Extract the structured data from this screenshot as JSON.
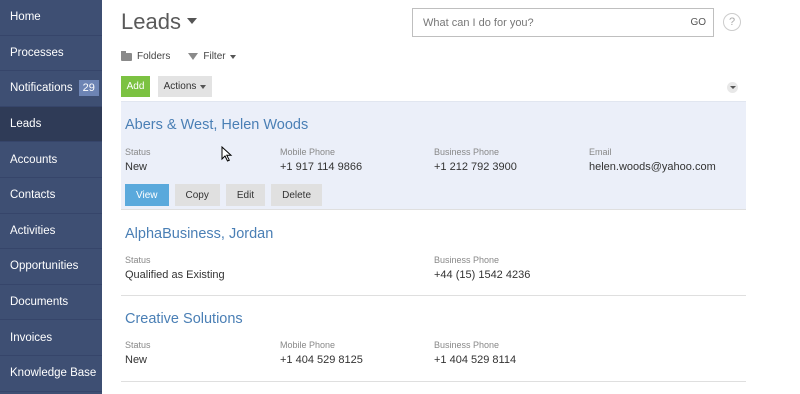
{
  "sidebar": {
    "items": [
      {
        "label": "Home"
      },
      {
        "label": "Processes"
      },
      {
        "label": "Notifications",
        "badge": "29"
      },
      {
        "label": "Leads"
      },
      {
        "label": "Accounts"
      },
      {
        "label": "Contacts"
      },
      {
        "label": "Activities"
      },
      {
        "label": "Opportunities"
      },
      {
        "label": "Documents"
      },
      {
        "label": "Invoices"
      },
      {
        "label": "Knowledge Base"
      }
    ]
  },
  "header": {
    "title": "Leads",
    "search_placeholder": "What can I do for you?",
    "search_go": "GO",
    "help": "?"
  },
  "toolbar": {
    "folders": "Folders",
    "filter": "Filter",
    "add": "Add",
    "actions": "Actions"
  },
  "records": [
    {
      "title": "Abers & West, Helen Woods",
      "status_label": "Status",
      "status": "New",
      "mobile_label": "Mobile Phone",
      "mobile": "+1 917 114 9866",
      "business_label": "Business Phone",
      "business": "+1 212 792 3900",
      "email_label": "Email",
      "email": "helen.woods@yahoo.com",
      "buttons": {
        "view": "View",
        "copy": "Copy",
        "edit": "Edit",
        "delete": "Delete"
      }
    },
    {
      "title": "AlphaBusiness, Jordan",
      "status_label": "Status",
      "status": "Qualified as Existing",
      "business_label": "Business Phone",
      "business": "+44 (15) 1542 4236"
    },
    {
      "title": "Creative Solutions",
      "status_label": "Status",
      "status": "New",
      "mobile_label": "Mobile Phone",
      "mobile": "+1 404 529 8125",
      "business_label": "Business Phone",
      "business": "+1 404 529 8114"
    }
  ],
  "colors": {
    "sidebar_bg": "#3e4f73",
    "accent_link": "#4a7fb5",
    "add_green": "#7cc242",
    "view_blue": "#5aa9dc"
  }
}
